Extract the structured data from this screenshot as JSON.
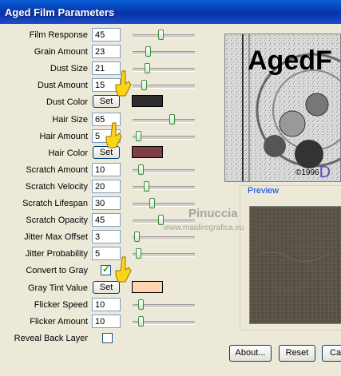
{
  "window": {
    "title": "Aged Film Parameters"
  },
  "params": [
    {
      "label": "Film Response",
      "value": "45",
      "slider": 0.45
    },
    {
      "label": "Grain Amount",
      "value": "23",
      "slider": 0.23
    },
    {
      "label": "Dust Size",
      "value": "21",
      "slider": 0.21
    },
    {
      "label": "Dust Amount",
      "value": "15",
      "slider": 0.15
    },
    {
      "label": "Dust Color",
      "button": "Set",
      "color": "#2e2e30"
    },
    {
      "label": "Hair Size",
      "value": "65",
      "slider": 0.65
    },
    {
      "label": "Hair Amount",
      "value": "5",
      "slider": 0.05
    },
    {
      "label": "Hair Color",
      "button": "Set",
      "color": "#7e3d47"
    },
    {
      "label": "Scratch Amount",
      "value": "10",
      "slider": 0.1
    },
    {
      "label": "Scratch Velocity",
      "value": "20",
      "slider": 0.2
    },
    {
      "label": "Scratch Lifespan",
      "value": "30",
      "slider": 0.3
    },
    {
      "label": "Scratch Opacity",
      "value": "45",
      "slider": 0.45
    },
    {
      "label": "Jitter Max Offset",
      "value": "3",
      "slider": 0.03
    },
    {
      "label": "Jitter Probability",
      "value": "5",
      "slider": 0.05
    },
    {
      "label": "Convert to Gray",
      "checkbox": true
    },
    {
      "label": "Gray Tint Value",
      "button": "Set",
      "color": "#fdd4b0"
    },
    {
      "label": "Flicker Speed",
      "value": "10",
      "slider": 0.1
    },
    {
      "label": "Flicker Amount",
      "value": "10",
      "slider": 0.1
    },
    {
      "label": "Reveal Back Layer",
      "checkbox": false
    }
  ],
  "logo": {
    "title": "AgedF",
    "copyright": "©1996",
    "copyright_letter": "D"
  },
  "preview": {
    "label": "Preview"
  },
  "watermark": {
    "name": "Pinuccia",
    "url": "www.maidiregrafica.eu"
  },
  "buttons": {
    "about": "About...",
    "reset": "Reset",
    "cancel": "Ca"
  },
  "colors": {
    "title_bar": "#0a5fd8",
    "dialog_bg": "#ece9d8",
    "slider_thumb": "#3c8a3c",
    "link": "#0046d5"
  }
}
